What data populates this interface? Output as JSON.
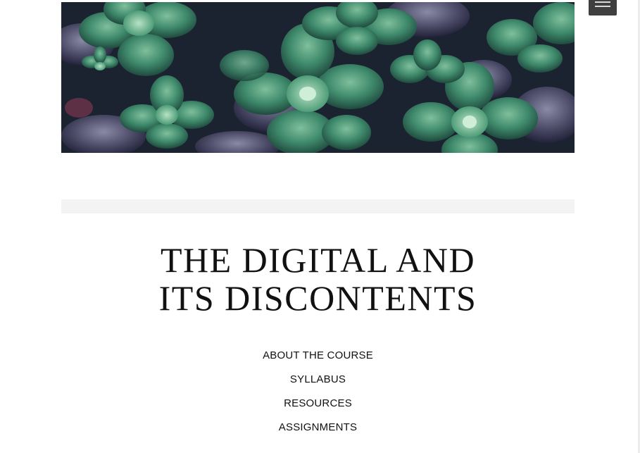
{
  "header": {
    "image_subject": "succulent plants header image"
  },
  "menu": {
    "icon": "hamburger-menu-icon"
  },
  "site": {
    "title_line1": "THE DIGITAL AND",
    "title_line2": "ITS DISCONTENTS"
  },
  "nav": {
    "items": [
      {
        "label": "ABOUT THE COURSE"
      },
      {
        "label": "SYLLABUS"
      },
      {
        "label": "RESOURCES"
      },
      {
        "label": "ASSIGNMENTS"
      }
    ]
  },
  "colors": {
    "text": "#111111",
    "menu_button": "#3f3f3f",
    "band": "#f3f3f3",
    "succulent_green": "#3f8a6c"
  }
}
